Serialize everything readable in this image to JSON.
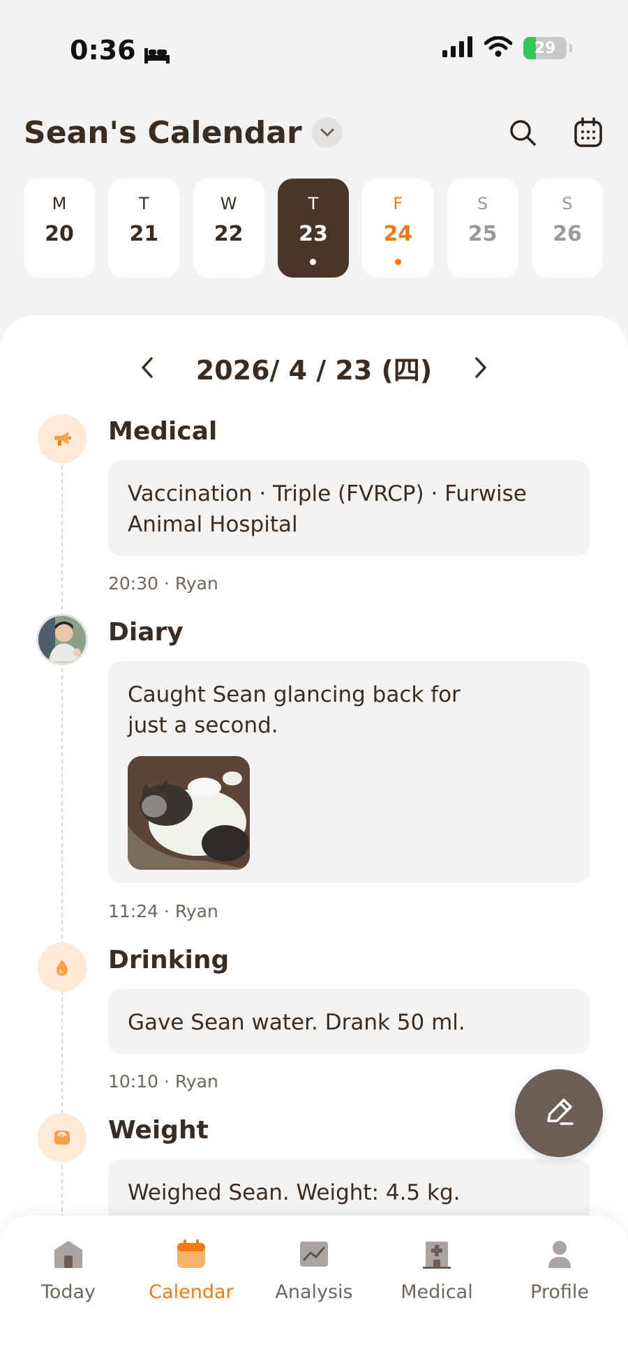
{
  "status_bar": {
    "time": "0:36",
    "battery": "29",
    "battery_level": 0.29,
    "icons": [
      "bed-icon",
      "signal-icon",
      "wifi-icon",
      "battery-icon"
    ]
  },
  "header": {
    "title": "Sean's Calendar",
    "icons": [
      "chevron-down-icon",
      "search-icon",
      "calendar-icon"
    ]
  },
  "week": [
    {
      "letter": "M",
      "num": "20"
    },
    {
      "letter": "T",
      "num": "21"
    },
    {
      "letter": "W",
      "num": "22"
    },
    {
      "letter": "T",
      "num": "23"
    },
    {
      "letter": "F",
      "num": "24"
    },
    {
      "letter": "S",
      "num": "25"
    },
    {
      "letter": "S",
      "num": "26"
    }
  ],
  "date_nav": {
    "label": "2026/ 4 / 23 (四)"
  },
  "entries": {
    "medical": {
      "title": "Medical",
      "text": "Vaccination · Triple (FVRCP) · Furwise Animal Hospital",
      "meta": "20:30 · Ryan"
    },
    "diary": {
      "title": "Diary",
      "text": "Caught Sean glancing back for just a second.",
      "meta": "11:24 · Ryan"
    },
    "drinking": {
      "title": "Drinking",
      "text": "Gave Sean water. Drank 50 ml.",
      "meta": "10:10 · Ryan"
    },
    "weight": {
      "title": "Weight",
      "text": "Weighed Sean. Weight: 4.5 kg."
    }
  },
  "tabs": [
    {
      "label": "Today"
    },
    {
      "label": "Calendar"
    },
    {
      "label": "Analysis"
    },
    {
      "label": "Medical"
    },
    {
      "label": "Profile"
    }
  ],
  "colors": {
    "accent": "#f07b12",
    "brown": "#4a3629",
    "card": "#f4f3f2",
    "icon_bg": "#fde9d6"
  }
}
